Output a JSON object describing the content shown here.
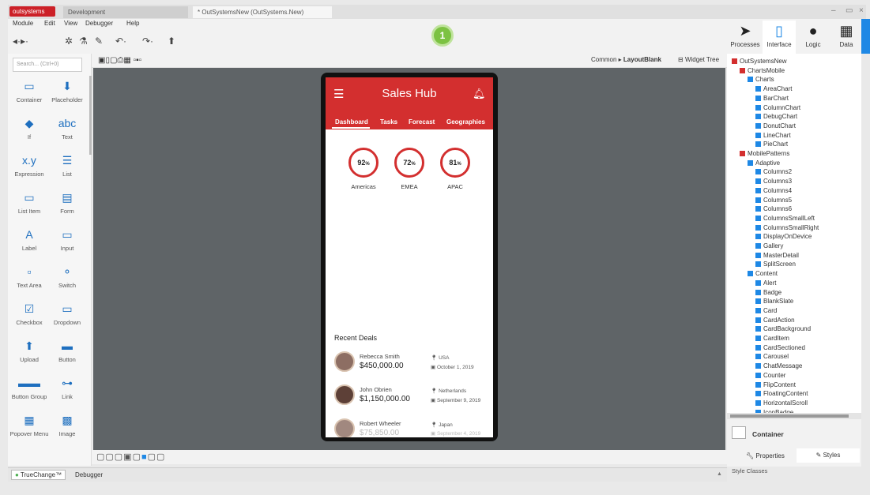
{
  "window": {
    "logo": "outsystems",
    "tabs": [
      "Development",
      "* OutSystemsNew (OutSystems.New)"
    ],
    "controls": [
      "–",
      "▭",
      "×"
    ]
  },
  "menu": [
    "Module",
    "Edit",
    "View",
    "Debugger",
    "Help"
  ],
  "step_badge": "1",
  "right_tabs": [
    "Processes",
    "Interface",
    "Logic",
    "Data"
  ],
  "toolbox": {
    "search_placeholder": "Search... (Ctrl+0)",
    "items": [
      {
        "label": "Container",
        "icon": "container-icon"
      },
      {
        "label": "Placeholder",
        "icon": "placeholder-icon"
      },
      {
        "label": "If",
        "icon": "if-icon"
      },
      {
        "label": "Text",
        "icon": "text-icon"
      },
      {
        "label": "Expression",
        "icon": "expression-icon"
      },
      {
        "label": "List",
        "icon": "list-icon"
      },
      {
        "label": "List Item",
        "icon": "list-item-icon"
      },
      {
        "label": "Form",
        "icon": "form-icon"
      },
      {
        "label": "Label",
        "icon": "label-icon"
      },
      {
        "label": "Input",
        "icon": "input-icon"
      },
      {
        "label": "Text Area",
        "icon": "text-area-icon"
      },
      {
        "label": "Switch",
        "icon": "switch-icon"
      },
      {
        "label": "Checkbox",
        "icon": "checkbox-icon"
      },
      {
        "label": "Dropdown",
        "icon": "dropdown-icon"
      },
      {
        "label": "Upload",
        "icon": "upload-icon"
      },
      {
        "label": "Button",
        "icon": "button-icon"
      },
      {
        "label": "Button Group",
        "icon": "button-group-icon"
      },
      {
        "label": "Link",
        "icon": "link-icon"
      },
      {
        "label": "Popover Menu",
        "icon": "popover-menu-icon"
      },
      {
        "label": "Image",
        "icon": "image-icon"
      }
    ]
  },
  "canvas": {
    "breadcrumb_parent": "Common",
    "breadcrumb_current": "LayoutBlank",
    "widget_tree": "Widget Tree"
  },
  "app": {
    "title": "Sales Hub",
    "tabs": [
      "Dashboard",
      "Tasks",
      "Forecast",
      "Geographies"
    ],
    "gauges": [
      {
        "value": "92",
        "unit": "%",
        "label": "Americas"
      },
      {
        "value": "72",
        "unit": "%",
        "label": "EMEA"
      },
      {
        "value": "81",
        "unit": "%",
        "label": "APAC"
      }
    ],
    "recent_title": "Recent Deals",
    "deals": [
      {
        "name": "Rebecca Smith",
        "amount": "$450,000.00",
        "country": "USA",
        "date": "October 1, 2019"
      },
      {
        "name": "John Obrien",
        "amount": "$1,150,000.00",
        "country": "Netherlands",
        "date": "September 9, 2019"
      },
      {
        "name": "Robert Wheeler",
        "amount": "$75,850.00",
        "country": "Japan",
        "date": "September 4, 2019"
      }
    ]
  },
  "status": {
    "truechange": "TrueChange™",
    "debugger": "Debugger"
  },
  "tree": [
    {
      "label": "OutSystemsNew",
      "level": 0
    },
    {
      "label": "ChartsMobile",
      "level": 1
    },
    {
      "label": "Charts",
      "level": 2
    },
    {
      "label": "AreaChart",
      "level": 3
    },
    {
      "label": "BarChart",
      "level": 3
    },
    {
      "label": "ColumnChart",
      "level": 3
    },
    {
      "label": "DebugChart",
      "level": 3
    },
    {
      "label": "DonutChart",
      "level": 3
    },
    {
      "label": "LineChart",
      "level": 3
    },
    {
      "label": "PieChart",
      "level": 3
    },
    {
      "label": "MobilePatterns",
      "level": 1
    },
    {
      "label": "Adaptive",
      "level": 2
    },
    {
      "label": "Columns2",
      "level": 3
    },
    {
      "label": "Columns3",
      "level": 3
    },
    {
      "label": "Columns4",
      "level": 3
    },
    {
      "label": "Columns5",
      "level": 3
    },
    {
      "label": "Columns6",
      "level": 3
    },
    {
      "label": "ColumnsSmallLeft",
      "level": 3
    },
    {
      "label": "ColumnsSmallRight",
      "level": 3
    },
    {
      "label": "DisplayOnDevice",
      "level": 3
    },
    {
      "label": "Gallery",
      "level": 3
    },
    {
      "label": "MasterDetail",
      "level": 3
    },
    {
      "label": "SplitScreen",
      "level": 3
    },
    {
      "label": "Content",
      "level": 2
    },
    {
      "label": "Alert",
      "level": 3
    },
    {
      "label": "Badge",
      "level": 3
    },
    {
      "label": "BlankSlate",
      "level": 3
    },
    {
      "label": "Card",
      "level": 3
    },
    {
      "label": "CardAction",
      "level": 3
    },
    {
      "label": "CardBackground",
      "level": 3
    },
    {
      "label": "CardItem",
      "level": 3
    },
    {
      "label": "CardSectioned",
      "level": 3
    },
    {
      "label": "Carousel",
      "level": 3
    },
    {
      "label": "ChatMessage",
      "level": 3
    },
    {
      "label": "Counter",
      "level": 3
    },
    {
      "label": "FlipContent",
      "level": 3
    },
    {
      "label": "FloatingContent",
      "level": 3
    },
    {
      "label": "HorizontalScroll",
      "level": 3
    },
    {
      "label": "IconBadge",
      "level": 3
    }
  ],
  "props": {
    "container_title": "Container",
    "tabs": [
      "Properties",
      "Styles"
    ],
    "style_classes": "Style Classes"
  },
  "colors": {
    "brand_red": "#d32f2f",
    "badge_green": "#7cc242",
    "canvas_gray": "#5f6467"
  }
}
